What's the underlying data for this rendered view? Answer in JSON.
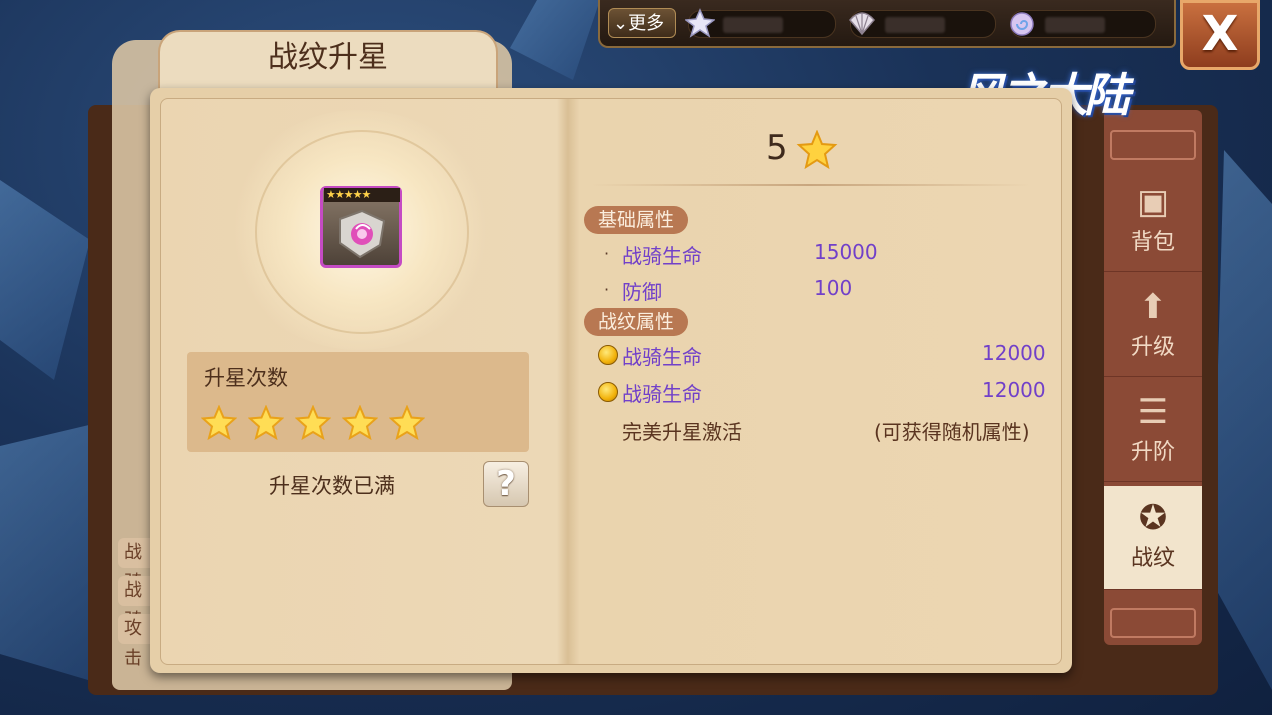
{
  "topbar": {
    "more_label": "更多",
    "resources": [
      {
        "icon": "star-currency-icon"
      },
      {
        "icon": "shell-currency-icon"
      },
      {
        "icon": "conch-currency-icon"
      }
    ],
    "close_label": "X"
  },
  "logo_text": "风之大陆",
  "panel": {
    "title": "战纹升星",
    "item": {
      "stars": "★★★★★"
    },
    "star_section_label": "升星次数",
    "star_count": 5,
    "max_text": "升星次数已满",
    "help_label": "?"
  },
  "detail": {
    "level": "5",
    "base_attr": {
      "header": "基础属性",
      "rows": [
        {
          "label": "战骑生命",
          "value": "15000"
        },
        {
          "label": "防御",
          "value": "100"
        }
      ]
    },
    "rune_attr": {
      "header": "战纹属性",
      "rows": [
        {
          "label": "战骑生命",
          "value": "12000"
        },
        {
          "label": "战骑生命",
          "value": "12000"
        }
      ]
    },
    "perfect": {
      "label": "完美升星激活",
      "value": "(可获得随机属性)"
    }
  },
  "side_tabs": [
    {
      "label": "背包",
      "icon": "backpack-icon"
    },
    {
      "label": "升级",
      "icon": "arrow-up-icon"
    },
    {
      "label": "升阶",
      "icon": "scroll-icon"
    },
    {
      "label": "战纹",
      "icon": "rune-emblem-icon",
      "active": true
    }
  ],
  "behind_labels": [
    "战骑",
    "战骑",
    "攻击"
  ],
  "colors": {
    "attr_text": "#7140c9",
    "section_header": "#b87852",
    "panel_bg": "#e6cfa8",
    "tab_bg": "#8b4a36"
  }
}
